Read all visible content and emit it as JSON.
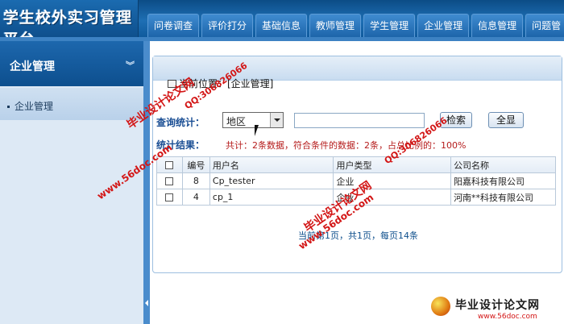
{
  "app": {
    "logo": "学生校外实习管理平台"
  },
  "nav": {
    "tabs": [
      "问卷调查",
      "评价打分",
      "基础信息",
      "教师管理",
      "学生管理",
      "企业管理",
      "信息管理",
      "问题管"
    ]
  },
  "sidebar": {
    "title": "企业管理",
    "items": [
      "企业管理"
    ]
  },
  "breadcrumb": {
    "text": "当前位置：[企业管理]"
  },
  "query": {
    "label": "查询统计：",
    "select_value": "地区",
    "input_value": "",
    "search_label": "检索",
    "show_all_label": "全显"
  },
  "stats": {
    "label": "统计结果：",
    "text": "共计：2条数据，符合条件的数据：2条，占总比例的：100%"
  },
  "table": {
    "headers": [
      "",
      "编号",
      "用户名",
      "用户类型",
      "公司名称"
    ],
    "rows": [
      {
        "no": "8",
        "user": "Cp_tester",
        "type": "企业",
        "company": "阳嘉科技有限公司"
      },
      {
        "no": "4",
        "user": "cp_1",
        "type": "企业",
        "company": "河南**科技有限公司"
      }
    ]
  },
  "pager": {
    "text": "当前第1页，共1页，每页14条"
  },
  "watermark": {
    "site": "毕业设计论文网",
    "url": "www.56doc.com",
    "qq": "QQ:306826066",
    "url_small": "www.56doc.com"
  },
  "colors": {
    "header": "#1e6fb4",
    "accent": "#1a4e94",
    "stats": "#b51b1b",
    "watermark_red": "#d31616",
    "watermark_blue": "#1240b0"
  },
  "icons": {
    "sidebar_chevron": "chevron-down-icon",
    "breadcrumb": "page-icon",
    "select": "dropdown-arrow-icon",
    "cursor": "mouse-cursor-icon"
  }
}
